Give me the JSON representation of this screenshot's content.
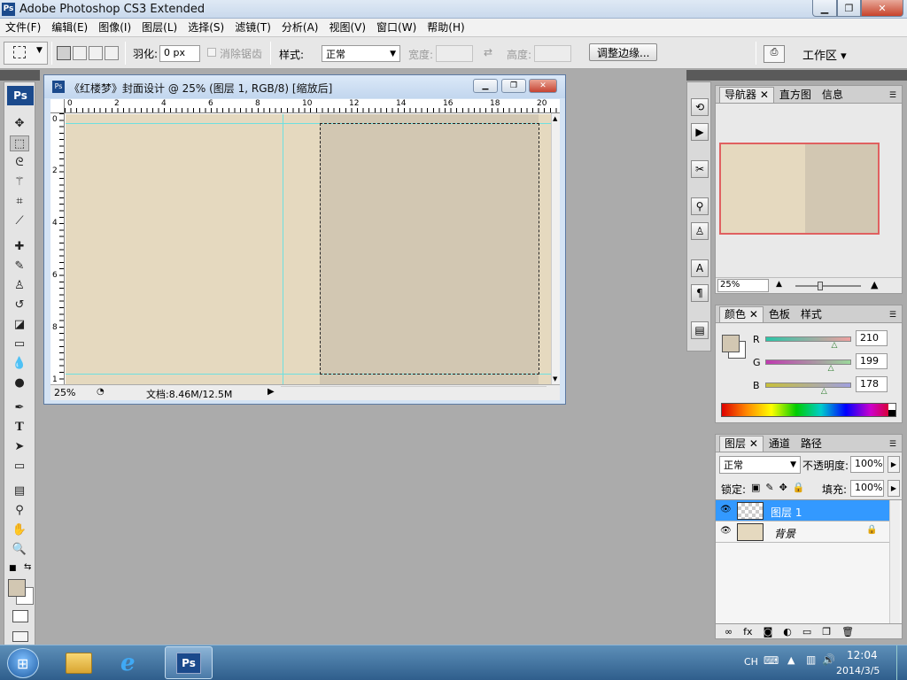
{
  "window": {
    "title": "Adobe Photoshop CS3 Extended",
    "app_icon": "Ps",
    "buttons": [
      "minimize",
      "maximize",
      "close"
    ]
  },
  "menu": [
    "文件(F)",
    "编辑(E)",
    "图像(I)",
    "图层(L)",
    "选择(S)",
    "滤镜(T)",
    "分析(A)",
    "视图(V)",
    "窗口(W)",
    "帮助(H)"
  ],
  "options": {
    "feather_label": "羽化:",
    "feather_value": "0 px",
    "antialias_label": "消除锯齿",
    "style_label": "样式:",
    "style_value": "正常",
    "width_label": "宽度:",
    "height_label": "高度:",
    "refine_edge": "调整边缘...",
    "workspace": "工作区 ▾"
  },
  "toolbox": {
    "logo": "Ps"
  },
  "document": {
    "title": "《红楼梦》封面设计 @ 25% (图层 1, RGB/8) [缩放后]",
    "zoom": "25%",
    "doc_info": "文档:8.46M/12.5M",
    "ruler_h": [
      "0",
      "2",
      "4",
      "6",
      "8",
      "10",
      "12",
      "14",
      "16",
      "18",
      "20"
    ],
    "ruler_v": [
      "0",
      "2",
      "4",
      "6",
      "8",
      "1"
    ],
    "canvas_color_left": "#e5d9bf",
    "canvas_color_right": "#d2c7b2"
  },
  "navigator": {
    "tabs": [
      "导航器",
      "直方图",
      "信息"
    ],
    "zoom": "25%"
  },
  "color": {
    "tabs": [
      "颜色",
      "色板",
      "样式"
    ],
    "r_label": "R",
    "r_value": "210",
    "g_label": "G",
    "g_value": "199",
    "b_label": "B",
    "b_value": "178",
    "r_fraction": 0.82,
    "g_fraction": 0.78,
    "b_fraction": 0.7,
    "foreground": "#d2c7b2"
  },
  "layers": {
    "tabs": [
      "图层",
      "通道",
      "路径"
    ],
    "blend_mode": "正常",
    "opacity_label": "不透明度:",
    "opacity_value": "100%",
    "lock_label": "锁定:",
    "fill_label": "填充:",
    "fill_value": "100%",
    "items": [
      {
        "name": "图层 1",
        "selected": true
      },
      {
        "name": "背景",
        "selected": false,
        "locked": true
      }
    ]
  },
  "taskbar": {
    "lang": "CH",
    "time": "12:04",
    "date": "2014/3/5",
    "apps": [
      "explorer",
      "internet-explorer",
      "photoshop"
    ]
  }
}
